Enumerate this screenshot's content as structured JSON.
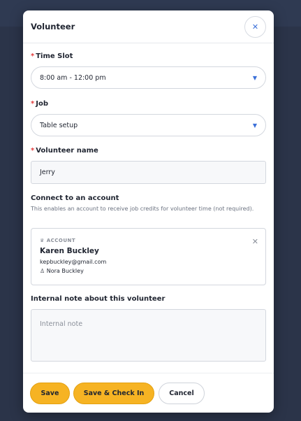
{
  "modal": {
    "title": "Volunteer",
    "close_icon": "close-icon"
  },
  "time_slot": {
    "required_mark": "*",
    "label": "Time Slot",
    "value": "8:00 am - 12:00 pm",
    "caret_icon": "chevron-down-icon"
  },
  "job": {
    "required_mark": "*",
    "label": "Job",
    "value": "Table setup",
    "caret_icon": "chevron-down-icon"
  },
  "volunteer_name": {
    "required_mark": "*",
    "label": "Volunteer name",
    "value": "Jerry"
  },
  "connect_account": {
    "label": "Connect to an account",
    "help": "This enables an account to receive job credits for volunteer time (not required).",
    "card": {
      "kicker": "ACCOUNT",
      "kicker_icon": "crown-icon",
      "name": "Karen Buckley",
      "email": "kepbuckley@gmail.com",
      "member": "Nora Buckley",
      "member_icon": "person-icon",
      "remove_icon": "close-icon"
    }
  },
  "internal_note": {
    "label": "Internal note about this volunteer",
    "placeholder": "Internal note",
    "value": ""
  },
  "footer": {
    "save_label": "Save",
    "save_checkin_label": "Save & Check In",
    "cancel_label": "Cancel"
  },
  "colors": {
    "accent_yellow": "#f6b323",
    "link_blue": "#3a6fd8",
    "required_red": "#e23b3b",
    "backdrop": "#2b3449"
  }
}
